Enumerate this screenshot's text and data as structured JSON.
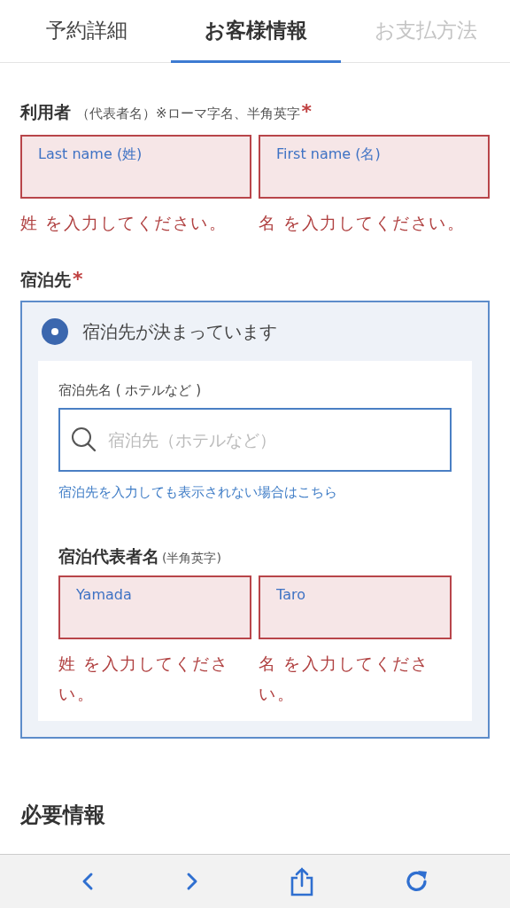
{
  "tabs": [
    {
      "label": "予約詳細",
      "selected": false,
      "disabled": false
    },
    {
      "label": "お客様情報",
      "selected": true,
      "disabled": false
    },
    {
      "label": "お支払方法",
      "selected": false,
      "disabled": true
    }
  ],
  "user": {
    "label": "利用者",
    "note": "（代表者名）",
    "hint": "※ローマ字名、半角英字",
    "required_mark": "*",
    "fields": [
      {
        "placeholder": "Last name (姓)",
        "error": true,
        "error_text": "姓 を入力してください。"
      },
      {
        "placeholder": "First name (名)",
        "error": true,
        "error_text": "名 を入力してください。"
      }
    ]
  },
  "lodging": {
    "label": "宿泊先",
    "required_mark": "*",
    "option": {
      "label": "宿泊先が決まっています",
      "selected": true
    },
    "name_label": "宿泊先名 ( ホテルなど )",
    "search": {
      "placeholder": "宿泊先（ホテルなど）"
    },
    "link": "宿泊先を入力しても表示されない場合はこちら",
    "rep_label": "宿泊代表者名",
    "rep_note": "(半角英字)",
    "rep_fields": [
      {
        "placeholder": "Yamada",
        "error": true,
        "error_text": "姓 を入力してください。"
      },
      {
        "placeholder": "Taro",
        "error": true,
        "error_text": "名 を入力してください。"
      }
    ]
  },
  "next_section": "必要情報"
}
